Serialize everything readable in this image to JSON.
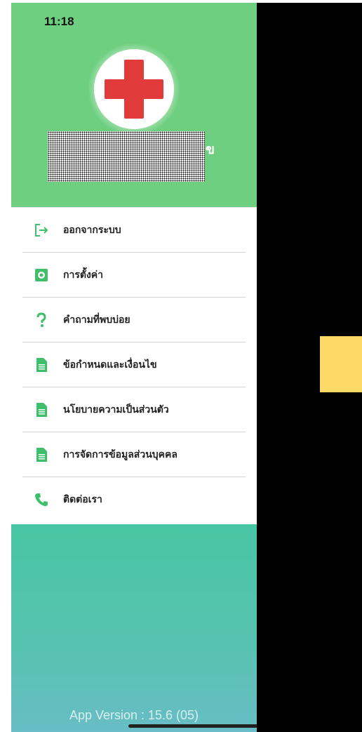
{
  "status_bar": {
    "time": "11:18"
  },
  "header": {
    "logo_icon": "red-cross-icon",
    "username_visible_tail": "ข",
    "colors": {
      "header_bg": "#6fcf80",
      "cross": "#e23b3b"
    }
  },
  "menu": {
    "items": [
      {
        "label": "ออกจากระบบ",
        "icon": "logout-icon"
      },
      {
        "label": "การตั้งค่า",
        "icon": "settings-icon"
      },
      {
        "label": "คำถามที่พบบ่อย",
        "icon": "question-icon"
      },
      {
        "label": "ข้อกำหนดและเงื่อนไข",
        "icon": "document-icon"
      },
      {
        "label": "นโยบายความเป็นส่วนตัว",
        "icon": "document-icon"
      },
      {
        "label": "การจัดการข้อมูลส่วนบุคคล",
        "icon": "document-icon"
      },
      {
        "label": "ติดต่อเรา",
        "icon": "phone-icon"
      }
    ],
    "colors": {
      "icon": "#3fbf6a",
      "label": "#222222"
    }
  },
  "footer": {
    "app_version": "App Version : 15.6 (05)"
  },
  "overlay": {
    "colors": {
      "backdrop": "#000000",
      "accent_block": "#fdd968"
    }
  }
}
